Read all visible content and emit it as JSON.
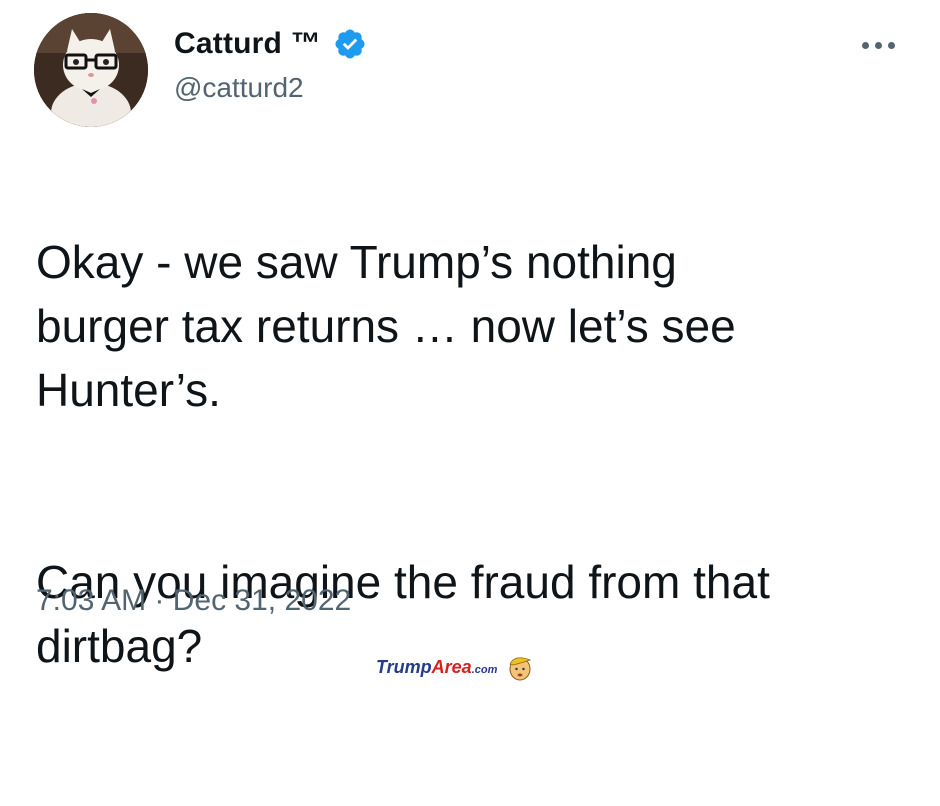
{
  "author": {
    "display_name": "Catturd ™",
    "handle": "@catturd2",
    "verified": true,
    "avatar_icon": "cat-with-glasses-avatar"
  },
  "more_icon": "more-horizontal-icon",
  "tweet": {
    "paragraph_1": "Okay - we saw Trump’s nothing\nburger tax returns … now let’s see\nHunter’s.",
    "paragraph_2": "Can you imagine the fraud from that\ndirtbag?"
  },
  "timestamp": "7:03 AM · Dec 31, 2022",
  "watermark": {
    "part1": "Trump",
    "part2": "Area",
    "part3": ".com",
    "icon": "trump-face-logo"
  },
  "colors": {
    "verified_blue": "#1d9bf0",
    "text_primary": "#0f1419",
    "text_secondary": "#536471"
  }
}
